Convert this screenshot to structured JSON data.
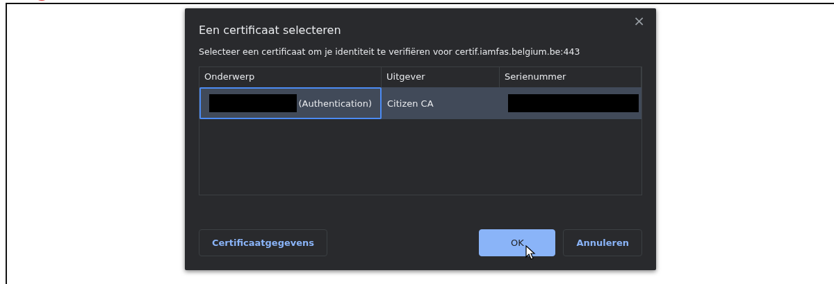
{
  "dialog": {
    "title": "Een certificaat selecteren",
    "close": "×",
    "message": "Selecteer een certificaat om je identiteit te verifiëren voor certif.iamfas.belgium.be:443",
    "table": {
      "columns": [
        "Onderwerp",
        "Uitgever",
        "Serienummer"
      ],
      "rows": [
        {
          "subject": "(Authentication)",
          "issuer": "Citizen CA",
          "selected": true,
          "focused": true
        }
      ]
    },
    "buttons": [
      {
        "label": "Certificaatgegevens",
        "kind": "secondary"
      },
      {
        "label": "OK",
        "kind": "primary"
      },
      {
        "label": "Annuleren",
        "kind": "secondary"
      }
    ]
  }
}
